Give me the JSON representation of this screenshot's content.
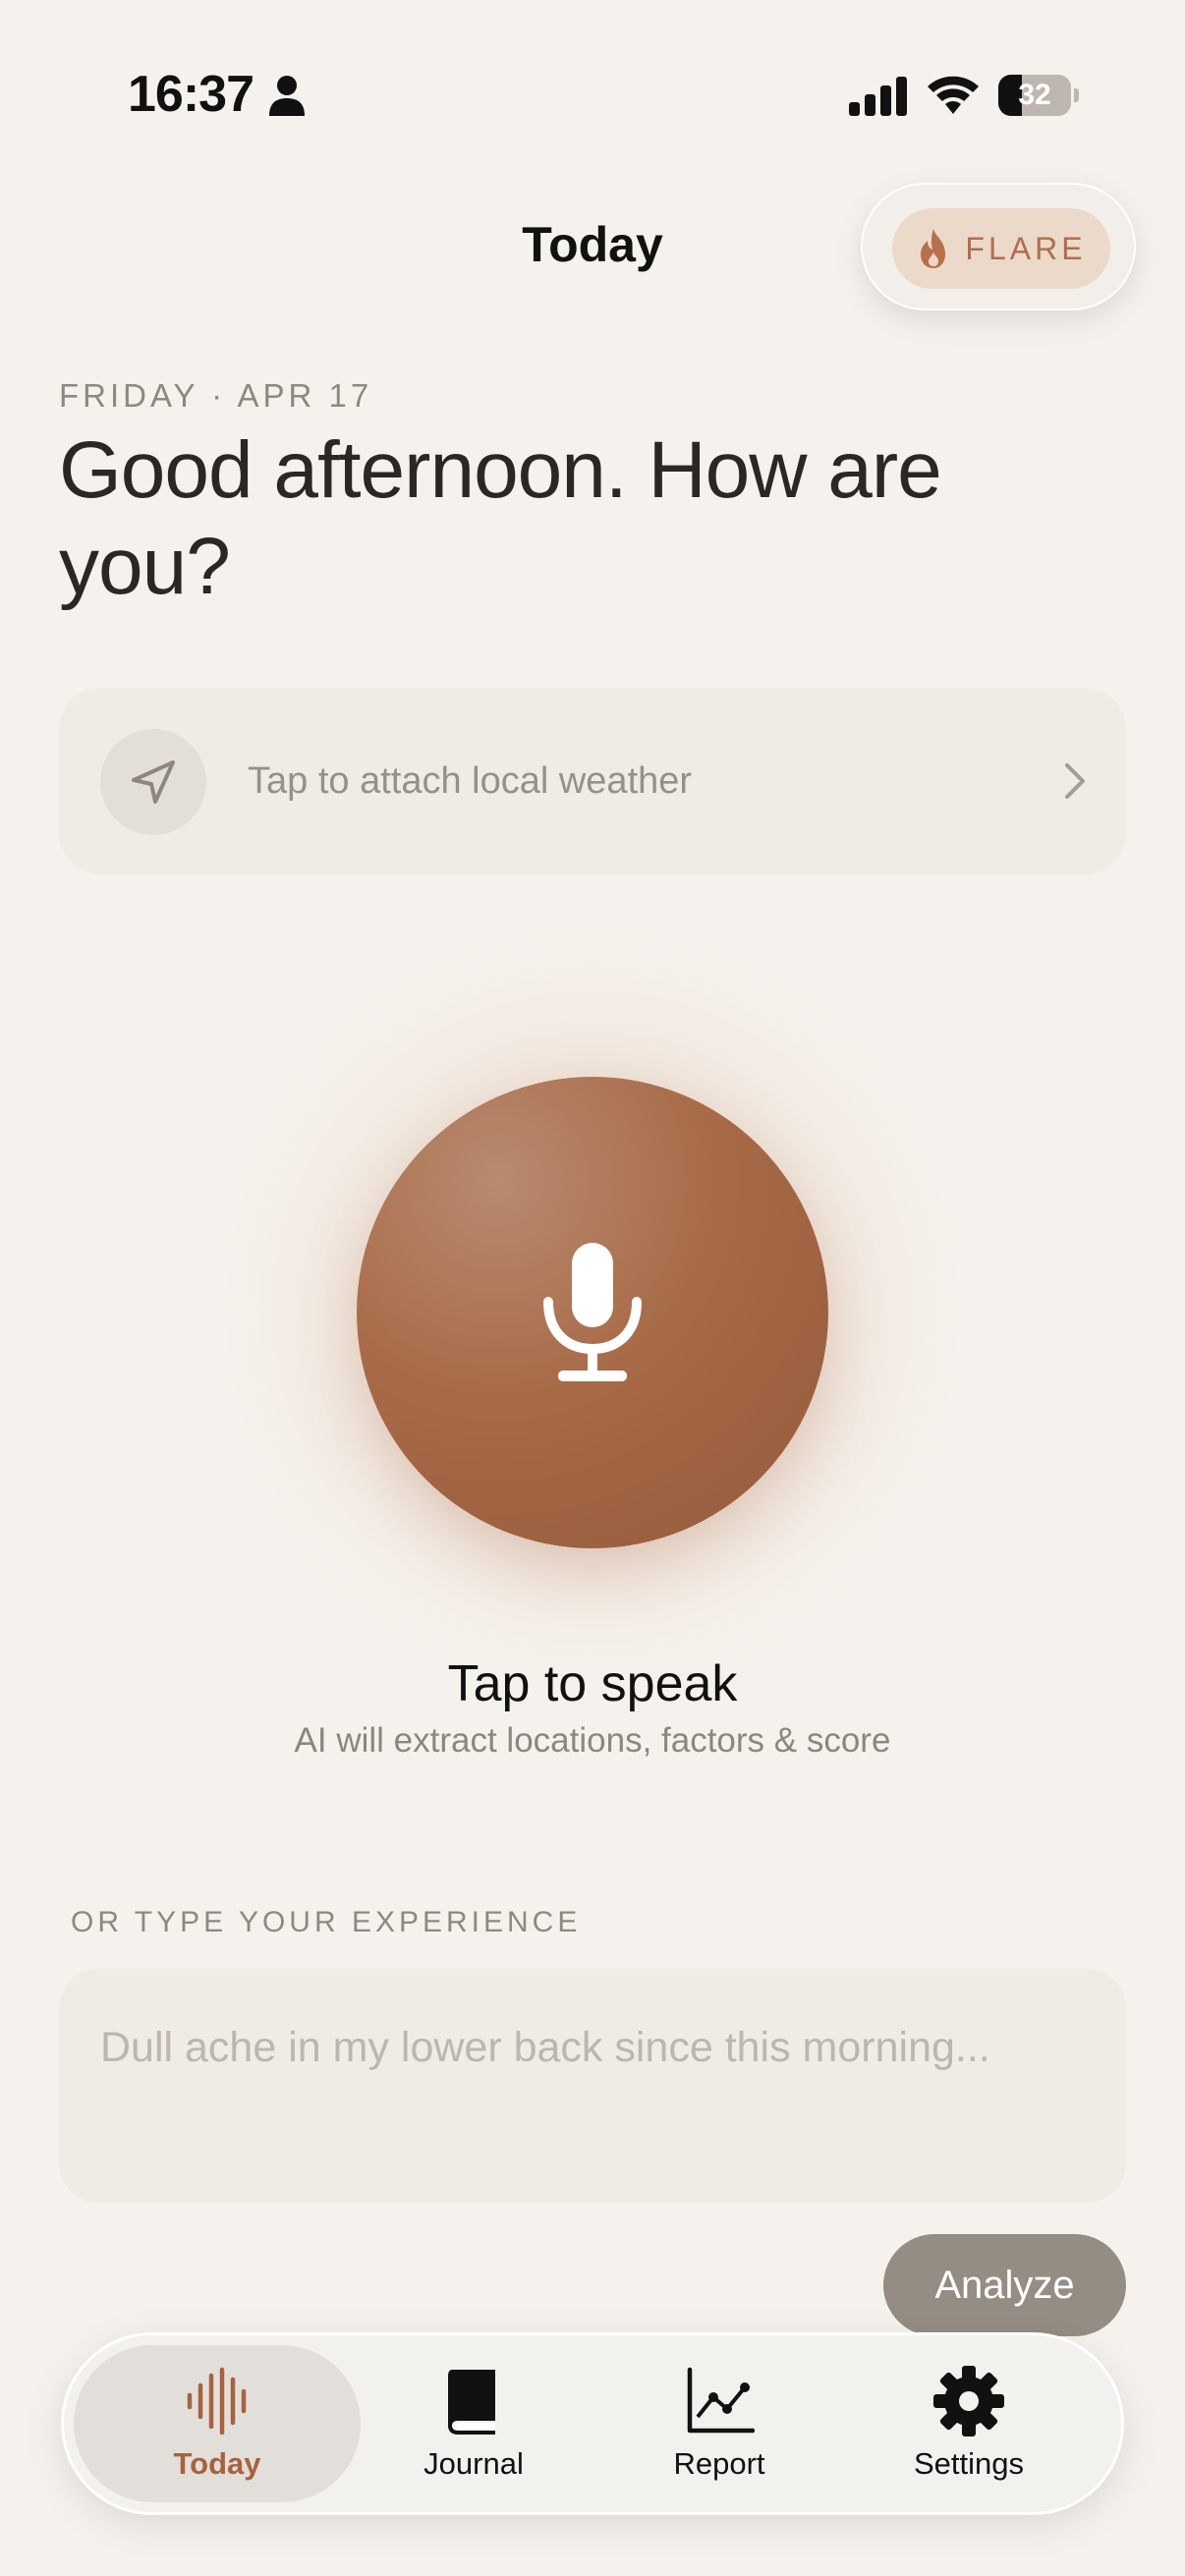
{
  "status_bar": {
    "time": "16:37",
    "battery_level": "32",
    "battery_fraction": 0.32,
    "icons": [
      "person-icon",
      "signal-icon",
      "wifi-icon",
      "battery-icon"
    ]
  },
  "header": {
    "title": "Today",
    "flare_label": "FLARE",
    "flare_icon": "flame-icon"
  },
  "greeting": {
    "date": "FRIDAY · APR 17",
    "text": "Good afternoon. How are you?"
  },
  "weather": {
    "label": "Tap to attach local weather",
    "icon": "location-arrow-icon"
  },
  "voice": {
    "title": "Tap to speak",
    "subtitle": "AI will extract locations, factors & score",
    "icon": "microphone-icon"
  },
  "type_section": {
    "label": "OR TYPE YOUR EXPERIENCE",
    "placeholder": "Dull ache in my lower back since this morning...",
    "value": ""
  },
  "analyze_label": "Analyze",
  "tabs": [
    {
      "label": "Today",
      "icon": "waveform-icon",
      "active": true
    },
    {
      "label": "Journal",
      "icon": "book-icon",
      "active": false
    },
    {
      "label": "Report",
      "icon": "chart-icon",
      "active": false
    },
    {
      "label": "Settings",
      "icon": "gear-icon",
      "active": false
    }
  ],
  "colors": {
    "background": "#f5f2ed",
    "accent": "#a8623f",
    "card": "#efebe5",
    "muted_text": "#8f8880"
  }
}
